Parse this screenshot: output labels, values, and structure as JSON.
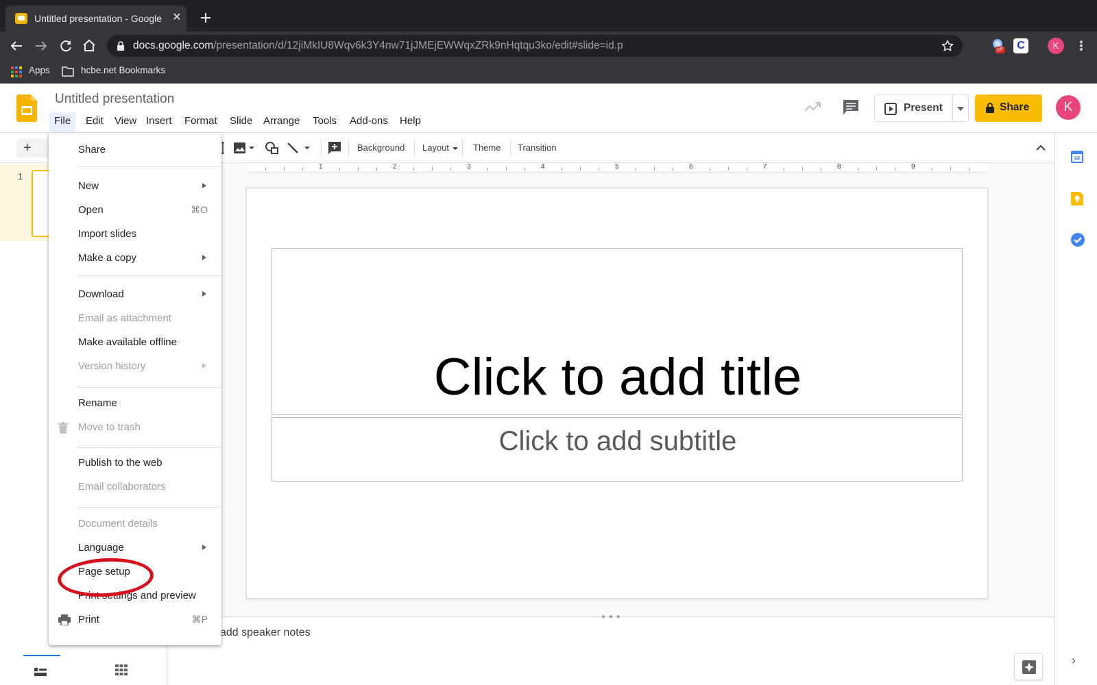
{
  "browser": {
    "tab_title": "Untitled presentation - Google S",
    "url_host": "docs.google.com",
    "url_path": "/presentation/d/12jiMkIU8Wqv6k3Y4nw71jJMEjEWWqxZRk9nHqtqu3ko/edit#slide=id.p",
    "ext_badge": "off",
    "ext_letter": "C",
    "avatar_letter": "K",
    "bookmarks": {
      "apps": "Apps",
      "folder": "hcbe.net Bookmarks"
    }
  },
  "header": {
    "doc_title": "Untitled presentation",
    "menus": [
      "File",
      "Edit",
      "View",
      "Insert",
      "Format",
      "Slide",
      "Arrange",
      "Tools",
      "Add-ons",
      "Help"
    ],
    "present_label": "Present",
    "share_label": "Share",
    "avatar_letter": "K"
  },
  "toolbar": {
    "background": "Background",
    "layout": "Layout",
    "theme": "Theme",
    "transition": "Transition"
  },
  "ruler": {
    "labels": [
      "1",
      "2",
      "3",
      "4",
      "5",
      "6",
      "7",
      "8",
      "9"
    ]
  },
  "filmstrip": {
    "slide_number": "1"
  },
  "slide": {
    "title_placeholder": "Click to add title",
    "subtitle_placeholder": "Click to add subtitle"
  },
  "notes": {
    "placeholder": "add speaker notes"
  },
  "file_menu": {
    "items": [
      {
        "label": "Share"
      },
      {
        "label": "New",
        "submenu": true
      },
      {
        "label": "Open",
        "shortcut": "⌘O"
      },
      {
        "label": "Import slides"
      },
      {
        "label": "Make a copy",
        "submenu": true
      },
      {
        "label": "Download",
        "submenu": true
      },
      {
        "label": "Email as attachment",
        "disabled": true
      },
      {
        "label": "Make available offline"
      },
      {
        "label": "Version history",
        "submenu": true,
        "disabled": true
      },
      {
        "label": "Rename"
      },
      {
        "label": "Move to trash",
        "disabled": true
      },
      {
        "label": "Publish to the web"
      },
      {
        "label": "Email collaborators",
        "disabled": true
      },
      {
        "label": "Document details",
        "disabled": true
      },
      {
        "label": "Language",
        "submenu": true
      },
      {
        "label": "Page setup"
      },
      {
        "label": "Print settings and preview"
      },
      {
        "label": "Print",
        "shortcut": "⌘P"
      }
    ]
  },
  "colors": {
    "accent_yellow": "#fbbc04",
    "highlight_red": "#d4111d",
    "avatar_pink": "#e8457a"
  }
}
